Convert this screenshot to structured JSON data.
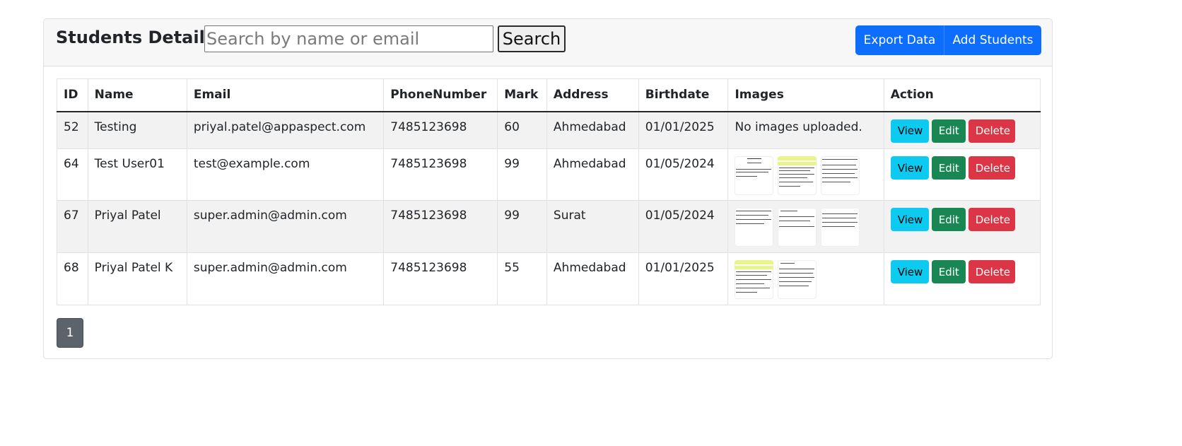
{
  "header": {
    "title": "Students Details",
    "search_placeholder": "Search by name or email",
    "search_label": "Search",
    "export_label": "Export Data",
    "add_label": "Add Students"
  },
  "table": {
    "columns": [
      "ID",
      "Name",
      "Email",
      "PhoneNumber",
      "Mark",
      "Address",
      "Birthdate",
      "Images",
      "Action"
    ],
    "rows": [
      {
        "id": "52",
        "name": "Testing",
        "email": "priyal.patel@appaspect.com",
        "phone": "7485123698",
        "mark": "60",
        "address": "Ahmedabad",
        "birthdate": "01/01/2025",
        "images_text": "No images uploaded."
      },
      {
        "id": "64",
        "name": "Test User01",
        "email": "test@example.com",
        "phone": "7485123698",
        "mark": "99",
        "address": "Ahmedabad",
        "birthdate": "01/05/2024",
        "images_text": ""
      },
      {
        "id": "67",
        "name": "Priyal Patel",
        "email": "super.admin@admin.com",
        "phone": "7485123698",
        "mark": "99",
        "address": "Surat",
        "birthdate": "01/05/2024",
        "images_text": ""
      },
      {
        "id": "68",
        "name": "Priyal Patel K",
        "email": "super.admin@admin.com",
        "phone": "7485123698",
        "mark": "55",
        "address": "Ahmedabad",
        "birthdate": "01/01/2025",
        "images_text": ""
      }
    ],
    "actions": {
      "view": "View",
      "edit": "Edit",
      "delete": "Delete"
    }
  },
  "pagination": {
    "current_page": "1"
  }
}
